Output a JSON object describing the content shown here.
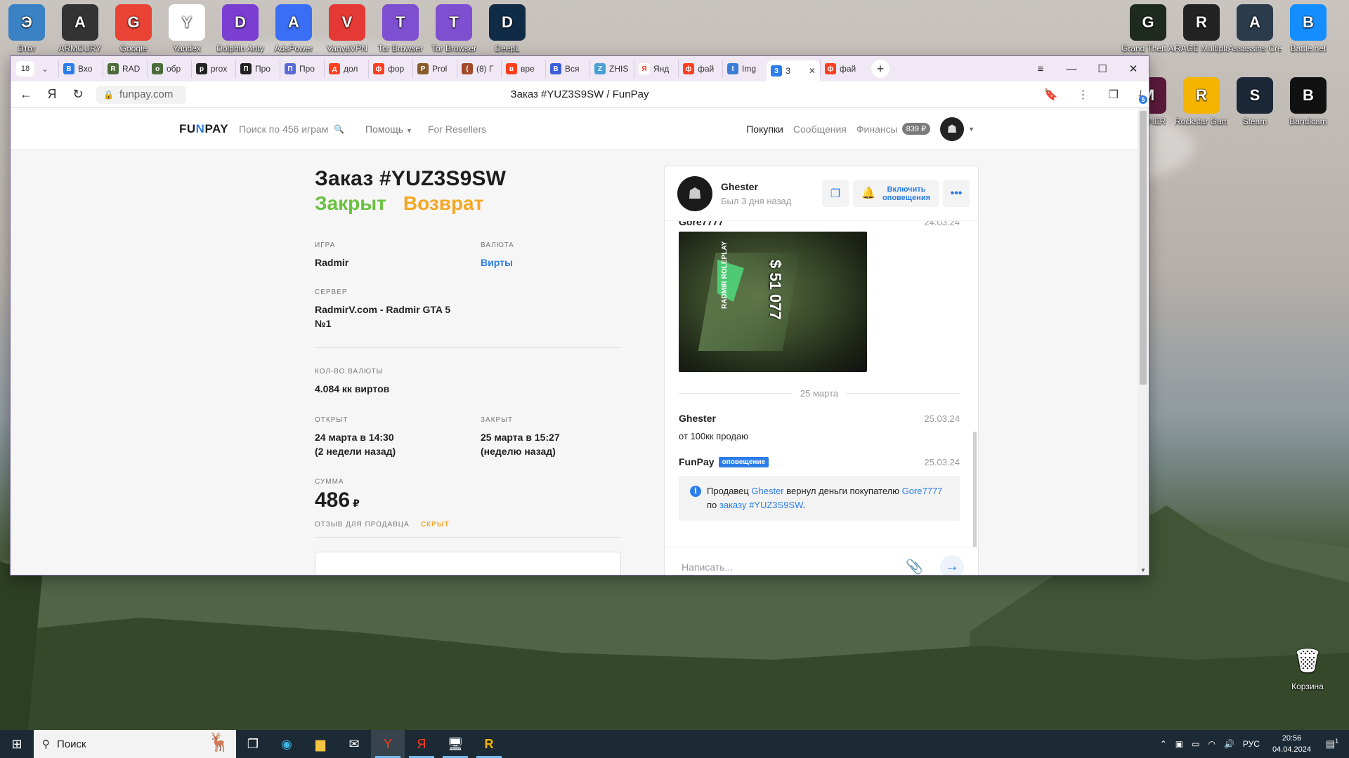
{
  "desktop": {
    "left_icons": [
      {
        "label": "Этот",
        "icon": "computer-icon",
        "color": "#3b82c4"
      },
      {
        "label": "ARMOURY",
        "icon": "armoury-icon",
        "color": "#333333"
      },
      {
        "label": "Google",
        "icon": "chrome-icon",
        "color": "#ea4335"
      },
      {
        "label": "Yandex",
        "icon": "yandex-icon",
        "color": "#ffffff"
      },
      {
        "label": "Dolphin Anty",
        "icon": "dolphin-icon",
        "color": "#7a3fd1"
      },
      {
        "label": "AdsPower",
        "icon": "adspower-icon",
        "color": "#3a6ff5"
      },
      {
        "label": "VanyaVPN",
        "icon": "vpn-icon",
        "color": "#e53935"
      },
      {
        "label": "Tor Browser",
        "icon": "tor-icon",
        "color": "#7e4fd1"
      },
      {
        "label": "Tor Browser",
        "icon": "tor-icon",
        "color": "#7e4fd1"
      },
      {
        "label": "DeepL",
        "icon": "deepl-icon",
        "color": "#0f2b46"
      }
    ],
    "right_icons": [
      {
        "label": "Grand Theft Auto V",
        "icon": "gta-icon",
        "color": "#1e2a20"
      },
      {
        "label": "RAGE Multiplayer",
        "icon": "rage-icon",
        "color": "#222222"
      },
      {
        "label": "Assassins Creed -...",
        "icon": "assassins-icon",
        "color": "#2a3b4c"
      },
      {
        "label": "Battle.net",
        "icon": "battlenet-icon",
        "color": "#148eff"
      },
      {
        "label": "MIR HER",
        "icon": "mir-icon",
        "color": "#5a1a3a"
      },
      {
        "label": "Rockstar Games ...",
        "icon": "rockstar-icon",
        "color": "#f5b400"
      },
      {
        "label": "Steam",
        "icon": "steam-icon",
        "color": "#1b2838"
      },
      {
        "label": "Bandicam",
        "icon": "bandicam-icon",
        "color": "#111111"
      }
    ],
    "recycle_bin": {
      "label": "Корзина",
      "icon": "recycle-bin-icon"
    }
  },
  "browser": {
    "tab_count": "18",
    "tabs": [
      {
        "label": "Вхо",
        "icon": "mail-icon",
        "color": "#2b7de9"
      },
      {
        "label": "RAD",
        "icon": "pen-icon",
        "color": "#4a6b3a"
      },
      {
        "label": "обр",
        "icon": "pen-icon",
        "color": "#4a6b3a"
      },
      {
        "label": "prox",
        "icon": "proxy-icon",
        "color": "#222222"
      },
      {
        "label": "Про",
        "icon": "p-icon",
        "color": "#222222"
      },
      {
        "label": "Про",
        "icon": "at-icon",
        "color": "#5b6bd5"
      },
      {
        "label": "дол",
        "icon": "yandex-icon",
        "color": "#fc3f1d"
      },
      {
        "label": "фор",
        "icon": "yandex-icon",
        "color": "#fc3f1d"
      },
      {
        "label": "Prol",
        "icon": "game-icon",
        "color": "#8a5a2a"
      },
      {
        "label": "(8) Г",
        "icon": "game-icon",
        "color": "#a04a2a"
      },
      {
        "label": "вре",
        "icon": "yandex-icon",
        "color": "#fc3f1d"
      },
      {
        "label": "Вся",
        "icon": "dot-icon",
        "color": "#3a5fd5"
      },
      {
        "label": "ZHIS",
        "icon": "leaf-icon",
        "color": "#4aa0d5"
      },
      {
        "label": "Янд",
        "icon": "yandex-icon",
        "color": "#ffffff"
      },
      {
        "label": "фай",
        "icon": "yandex-icon",
        "color": "#fc3f1d"
      },
      {
        "label": "Img",
        "icon": "image-icon",
        "color": "#3a7fd5"
      },
      {
        "label": "З",
        "icon": "funpay-icon",
        "color": "#2b7de9",
        "active": true
      },
      {
        "label": "фай",
        "icon": "yandex-icon",
        "color": "#fc3f1d"
      }
    ],
    "url": "funpay.com",
    "page_title": "Заказ #YUZ3S9SW / FunPay",
    "downloads_badge": "5"
  },
  "site": {
    "logo": "FUNPAY",
    "search_placeholder": "Поиск по 456 играм",
    "nav": {
      "help": "Помощь",
      "resellers": "For Resellers",
      "purchases": "Покупки",
      "messages": "Сообщения",
      "finances": "Финансы",
      "balance": "839 ₽"
    }
  },
  "order": {
    "title": "Заказ #YUZ3S9SW",
    "status_closed": "Закрыт",
    "status_refund": "Возврат",
    "game_label": "ИГРА",
    "game_value": "Radmir",
    "currency_label": "ВАЛЮТА",
    "currency_value": "Вирты",
    "server_label": "СЕРВЕР",
    "server_value": "RadmirV.com - Radmir GTA 5 №1",
    "amount_label": "КОЛ-ВО ВАЛЮТЫ",
    "amount_value": "4.084 кк виртов",
    "opened_label": "ОТКРЫТ",
    "opened_value": "24 марта в 14:30",
    "opened_ago": "(2 недели назад)",
    "closed_label": "ЗАКРЫТ",
    "closed_value": "25 марта в 15:27",
    "closed_ago": "(неделю назад)",
    "sum_label": "СУММА",
    "sum_value": "486",
    "sum_currency": "₽",
    "review_label": "ОТЗЫВ ДЛЯ ПРОДАВЦА",
    "review_status": "СКРЫТ"
  },
  "chat": {
    "user_name": "Ghester",
    "last_seen": "Был 3 дня назад",
    "notify_label_1": "Включить",
    "notify_label_2": "оповещения",
    "messages": [
      {
        "author": "Gore7777",
        "date": "24.03.24"
      },
      {
        "author": "Ghester",
        "date": "25.03.24",
        "text": "от 100кк продаю"
      },
      {
        "author": "FunPay",
        "badge": "оповещение",
        "date": "25.03.24"
      }
    ],
    "screenshot_money": "$ 51 077",
    "screenshot_brand": "RADMIR ROLEPLAY",
    "date_separator": "25 марта",
    "notice": {
      "t1": "Продавец ",
      "seller": "Ghester",
      "t2": " вернул деньги покупателю ",
      "buyer": "Gore7777",
      "t3": " по ",
      "order_link": "заказу #YUZ3S9SW",
      "t4": "."
    },
    "input_placeholder": "Написать..."
  },
  "taskbar": {
    "search_placeholder": "Поиск",
    "language": "РУС",
    "time": "20:56",
    "date": "04.04.2024",
    "notifications": "1"
  }
}
